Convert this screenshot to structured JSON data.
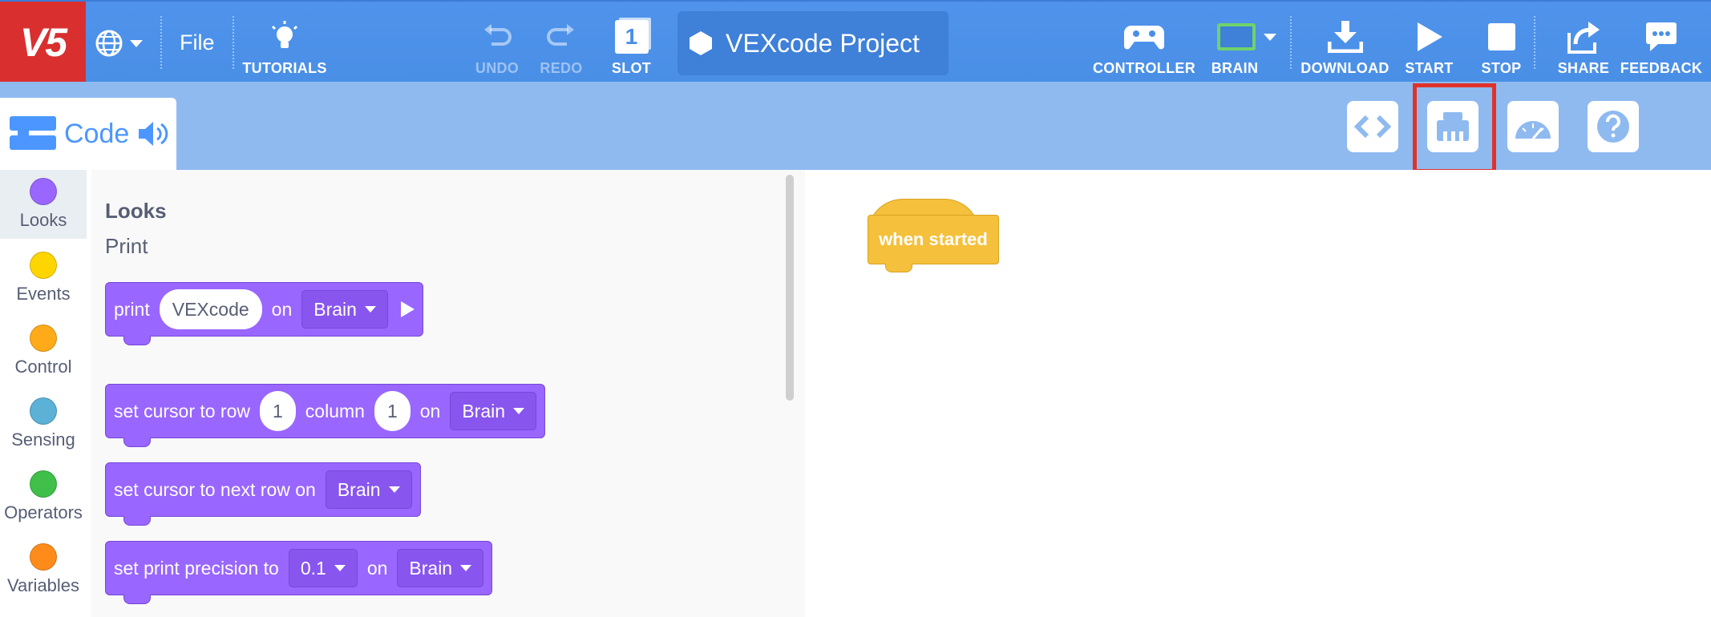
{
  "app": {
    "logo": "V5"
  },
  "toolbar": {
    "file_label": "File",
    "tutorials_label": "TUTORIALS",
    "undo_label": "UNDO",
    "redo_label": "REDO",
    "slot_label": "SLOT",
    "slot_number": "1",
    "project_name": "VEXcode Project",
    "controller_label": "CONTROLLER",
    "brain_label": "BRAIN",
    "download_label": "DOWNLOAD",
    "start_label": "START",
    "stop_label": "STOP",
    "share_label": "SHARE",
    "feedback_label": "FEEDBACK"
  },
  "code_tab": {
    "label": "Code"
  },
  "right_tools": [
    "code-viewer-icon",
    "devices-icon",
    "dashboard-icon",
    "help-icon"
  ],
  "categories": [
    {
      "label": "Looks",
      "color": "#9966ff"
    },
    {
      "label": "Events",
      "color": "#ffd500"
    },
    {
      "label": "Control",
      "color": "#ffab19"
    },
    {
      "label": "Sensing",
      "color": "#5cb1d6"
    },
    {
      "label": "Operators",
      "color": "#40bf4a"
    },
    {
      "label": "Variables",
      "color": "#ff8c1a"
    }
  ],
  "palette": {
    "section_title": "Looks",
    "subsection": "Print",
    "blocks": {
      "print": {
        "word": "print",
        "value": "VEXcode",
        "on": "on",
        "target": "Brain"
      },
      "set_cursor": {
        "prefix": "set cursor to row",
        "row": "1",
        "column_word": "column",
        "column": "1",
        "on": "on",
        "target": "Brain"
      },
      "next_row": {
        "prefix": "set cursor to next row on",
        "target": "Brain"
      },
      "precision": {
        "prefix": "set print precision to",
        "value": "0.1",
        "on": "on",
        "target": "Brain"
      }
    }
  },
  "workspace": {
    "hat_block": "when started"
  },
  "colors": {
    "toolbar": "#4c97ff",
    "highlight": "#e0322a",
    "looks": "#9966ff",
    "events": "#f5c03b"
  }
}
